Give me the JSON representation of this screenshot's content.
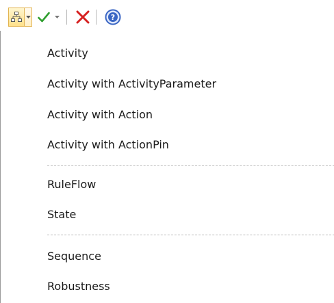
{
  "toolbar": {
    "icons": {
      "diagram": "diagram-hierarchy-icon",
      "dropdown": "chevron-down-icon",
      "check": "checkmark-icon",
      "close": "close-icon",
      "help": "help-icon"
    },
    "colors": {
      "check": "#2e9e2e",
      "close": "#d62020",
      "help": "#3a66c4",
      "highlight": "#ffe08a"
    }
  },
  "menu": {
    "group1": [
      "Activity",
      "Activity with ActivityParameter",
      "Activity with Action",
      "Activity with ActionPin"
    ],
    "group2": [
      "RuleFlow",
      "State"
    ],
    "group3": [
      "Sequence",
      "Robustness"
    ]
  }
}
